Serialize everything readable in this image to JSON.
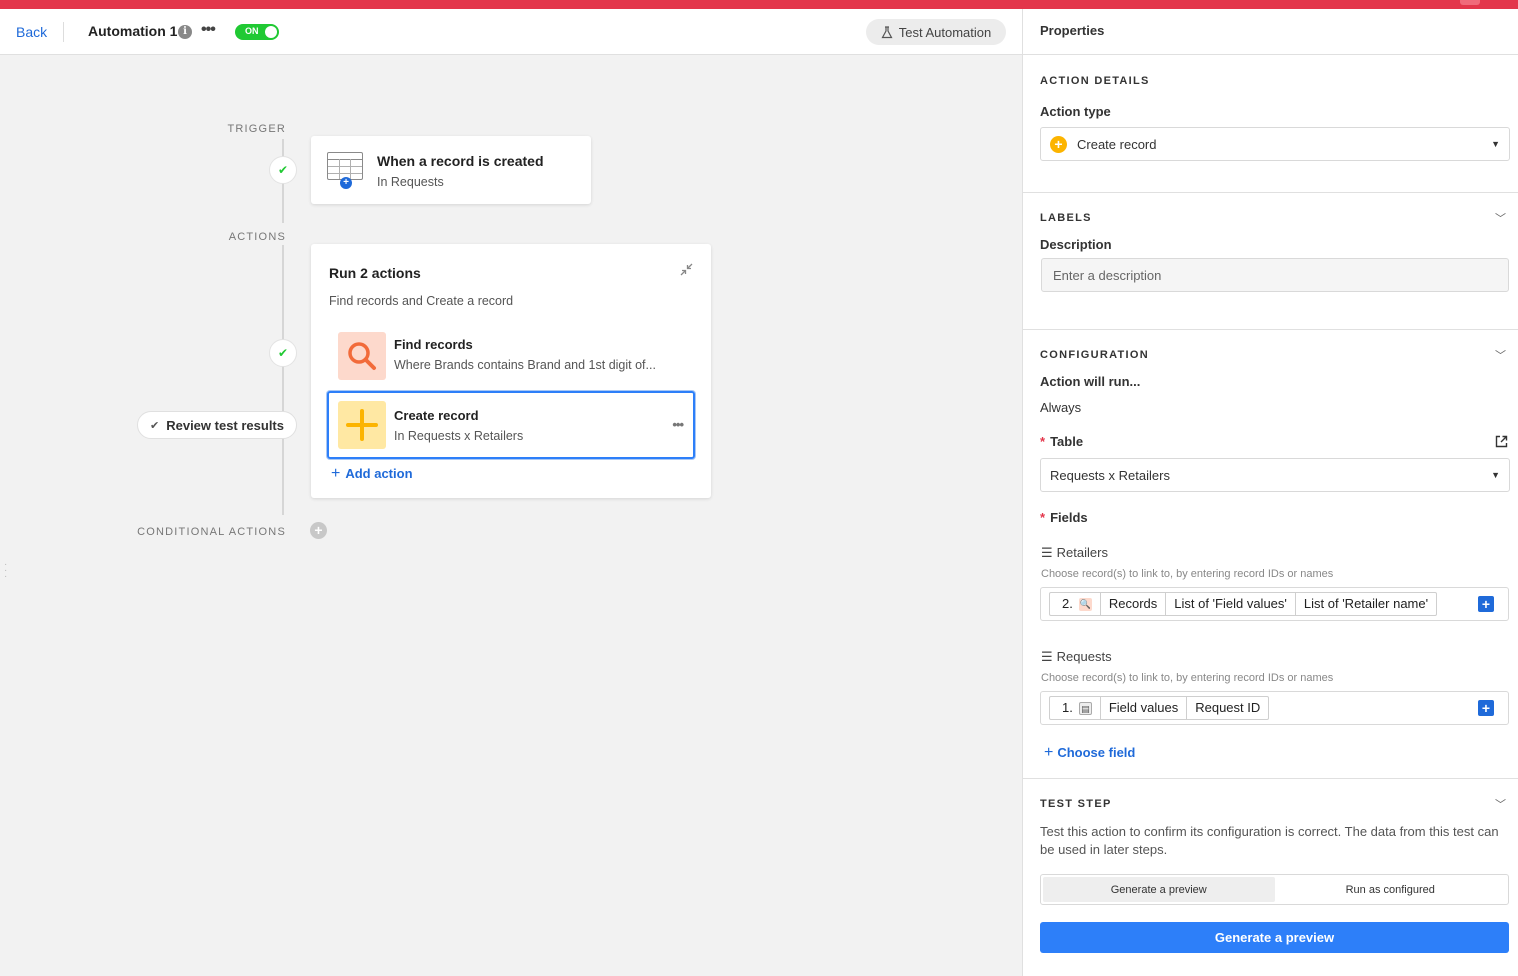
{
  "header": {
    "back_label": "Back",
    "automation_name": "Automation 1",
    "toggle_label": "ON",
    "test_label": "Test Automation"
  },
  "canvas": {
    "trigger_label": "TRIGGER",
    "actions_label": "ACTIONS",
    "conditional_label": "CONDITIONAL ACTIONS",
    "trigger": {
      "title": "When a record is created",
      "subtitle": "In Requests"
    },
    "run": {
      "title": "Run 2 actions",
      "subtitle": "Find records and Create a record"
    },
    "actions": [
      {
        "title": "Find records",
        "subtitle": "Where Brands contains Brand and 1st digit of..."
      },
      {
        "title": "Create record",
        "subtitle": "In Requests x Retailers"
      }
    ],
    "add_action_label": "Add action",
    "review_label": "Review test results"
  },
  "panel": {
    "title": "Properties",
    "action_details": {
      "section_title": "ACTION DETAILS",
      "action_type_label": "Action type",
      "action_type_value": "Create record"
    },
    "labels": {
      "section_title": "LABELS",
      "description_label": "Description",
      "description_placeholder": "Enter a description"
    },
    "configuration": {
      "section_title": "CONFIGURATION",
      "runs_label": "Action will run...",
      "runs_value": "Always",
      "table_label": "Table",
      "table_value": "Requests x Retailers",
      "fields_label": "Fields",
      "fields": [
        {
          "name": "Retailers",
          "help": "Choose record(s) to link to, by entering record IDs or names",
          "step": "2.",
          "tokens": [
            "Records",
            "List of 'Field values'",
            "List of 'Retailer name'"
          ]
        },
        {
          "name": "Requests",
          "help": "Choose record(s) to link to, by entering record IDs or names",
          "step": "1.",
          "tokens": [
            "Field values",
            "Request ID"
          ]
        }
      ],
      "choose_field_label": "Choose field"
    },
    "test_step": {
      "section_title": "TEST STEP",
      "description": "Test this action to confirm its configuration is correct. The data from this test can be used in later steps.",
      "seg_preview": "Generate a preview",
      "seg_run": "Run as configured",
      "button_label": "Generate a preview"
    }
  },
  "colors": {
    "accent_blue": "#1f6ad9",
    "primary_button": "#2d7ff9",
    "toggle_green": "#20c933",
    "top_bar_red": "#e3364b",
    "create_yellow": "#fcb400",
    "find_orange": "#f26b3a"
  },
  "icons": [
    "info-icon",
    "more-icon",
    "flask-icon",
    "table-icon",
    "check-icon",
    "collapse-icon",
    "search-icon",
    "plus-icon",
    "chevron-down-icon",
    "external-link-icon",
    "linked-field-icon"
  ]
}
